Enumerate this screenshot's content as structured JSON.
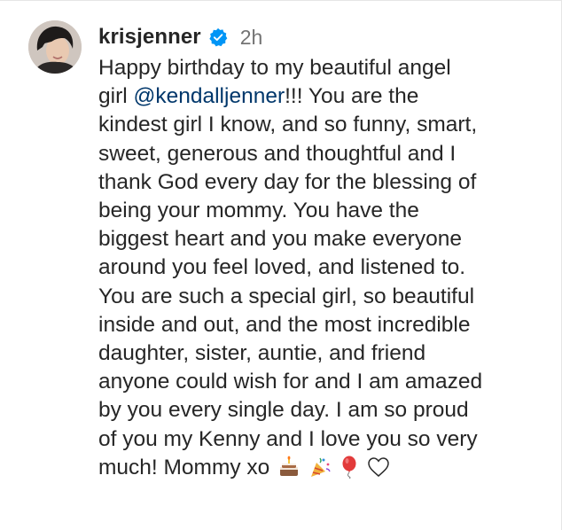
{
  "post": {
    "username": "krisjenner",
    "verified_icon": "verified-badge-icon",
    "timestamp": "2h",
    "caption_lines": {
      "l1": "Happy birthday to my beautiful angel",
      "l2_before": "girl ",
      "mention": "@kendalljenner",
      "l2_after": "!!! You are the",
      "l3": "kindest girl I know, and so funny, smart,",
      "l4": "sweet, generous and thoughtful and I",
      "l5": "thank God every day for the blessing of",
      "l6": "being your mommy. You have the",
      "l7": "biggest heart and you make everyone",
      "l8": "around you feel loved, and listened to.",
      "l9": "You are such a special girl, so beautiful",
      "l10": "inside and out, and the most incredible",
      "l11": "daughter, sister, auntie, and friend",
      "l12": "anyone could wish for and I am amazed",
      "l13": "by you every single day. I am so proud",
      "l14": "of you my Kenny and I love you so very",
      "l15": "much! Mommy xo"
    },
    "emojis": [
      "birthday-cake-icon",
      "party-popper-icon",
      "balloon-icon",
      "white-heart-icon"
    ]
  },
  "colors": {
    "text": "#262626",
    "muted": "#737373",
    "mention": "#00376b",
    "verified": "#0095f6"
  }
}
